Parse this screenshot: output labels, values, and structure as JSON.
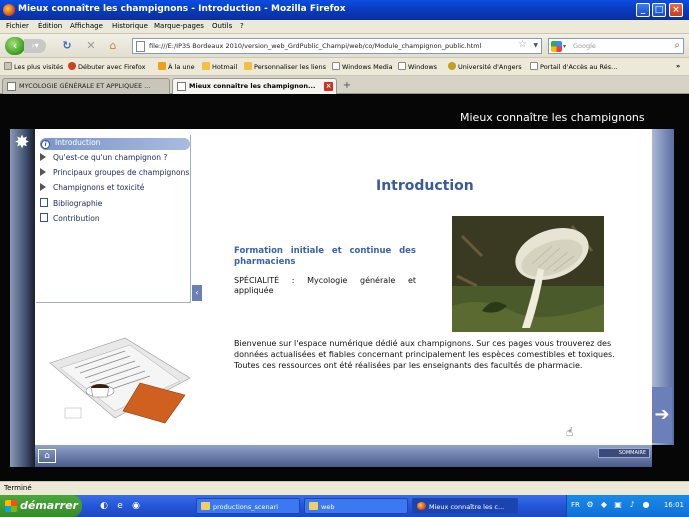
{
  "window": {
    "title": "Mieux connaître les champignons - Introduction - Mozilla Firefox"
  },
  "menubar": [
    "Fichier",
    "Édition",
    "Affichage",
    "Historique",
    "Marque-pages",
    "Outils",
    "?"
  ],
  "navbar": {
    "url": "file:///E:/IP3S Bordeaux 2010/version_web_GrdPublic_Champi/web/co/Module_champignon_public.html",
    "search_placeholder": "Google"
  },
  "bookmarks": [
    "Les plus visités",
    "Débuter avec Firefox",
    "À la une",
    "Hotmail",
    "Personnaliser les liens",
    "Windows Media",
    "Windows",
    "Université d'Angers",
    "Portail d'Accès au Rés..."
  ],
  "tabs": [
    {
      "label": "MYCOLOGIE GÉNÉRALE ET APPLIQUEE ...",
      "active": false
    },
    {
      "label": "Mieux connaître les champignon...",
      "active": true
    }
  ],
  "page": {
    "header": "Mieux connaître les champignons",
    "menu": [
      {
        "label": "Introduction",
        "icon": "info-icon",
        "active": true
      },
      {
        "label": "Qu'est-ce qu'un champignon ?",
        "icon": "arrow-icon",
        "active": false
      },
      {
        "label": "Principaux groupes de champignons",
        "icon": "arrow-icon",
        "active": false
      },
      {
        "label": "Champignons et toxicité",
        "icon": "arrow-icon",
        "active": false
      },
      {
        "label": "Bibliographie",
        "icon": "document-icon",
        "active": false
      },
      {
        "label": "Contribution",
        "icon": "document-icon",
        "active": false
      }
    ],
    "title": "Introduction",
    "formation": "Formation initiale et continue des pharmaciens",
    "specialite": "SPÉCIALITÉ : Mycologie générale et appliquée",
    "bienvenue": "Bienvenue sur l'espace numérique dédié aux champignons. Sur ces pages vous trouverez des données actualisées et fiables concernant principalement les espèces comestibles et toxiques. Toutes ces ressources ont été réalisées par les enseignants des facultés de pharmacie.",
    "sommaire": "SOMMAIRE"
  },
  "statusbar": {
    "text": "Terminé"
  },
  "taskbar": {
    "start": "démarrer",
    "tasks": [
      {
        "label": "productions_scenari",
        "active": false
      },
      {
        "label": "web",
        "active": false
      },
      {
        "label": "Mieux connaître les c...",
        "active": true
      }
    ],
    "lang": "FR",
    "clock": "16:01"
  },
  "colors": {
    "accent": "#3a5a9a",
    "titlebar": "#0a4ee0",
    "formation": "#3a62b0"
  }
}
